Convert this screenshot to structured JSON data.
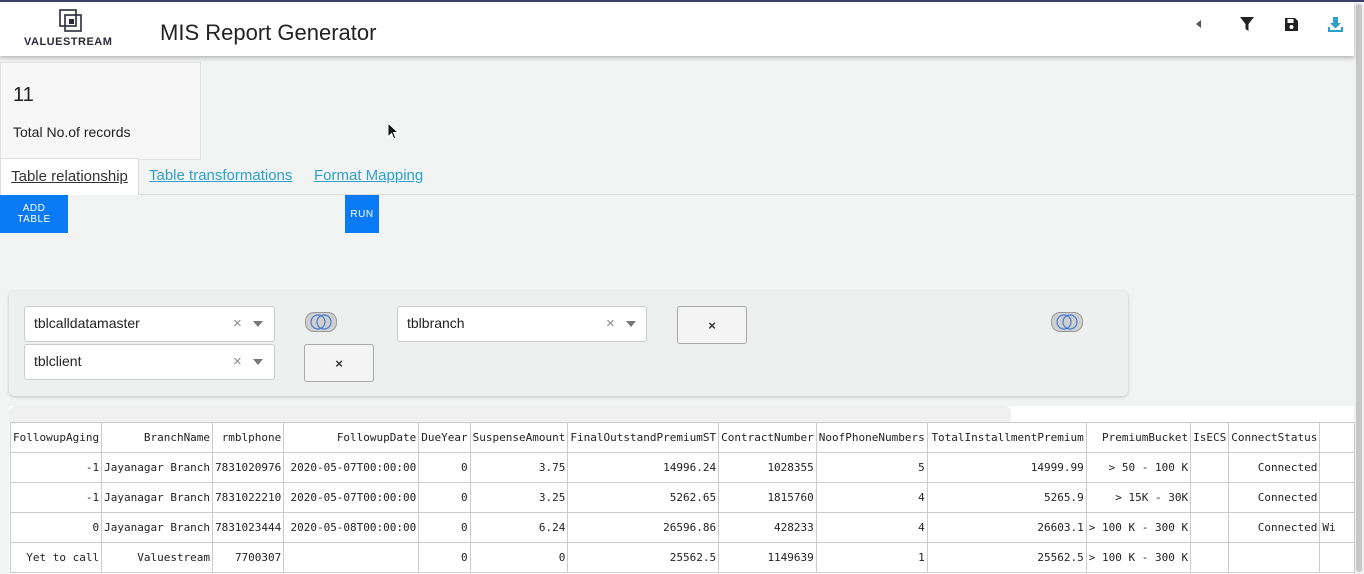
{
  "app": {
    "logo_text": "VALUESTREAM",
    "title": "MIS Report Generator"
  },
  "header_icons": [
    "collapse-left-icon",
    "filter-icon",
    "save-icon",
    "download-icon"
  ],
  "colors": {
    "accent": "#0b7bf5",
    "link": "#2ea0c8",
    "download": "#2ea0c8"
  },
  "stats": {
    "count": "11",
    "label": "Total No.of records"
  },
  "tabs": [
    {
      "label": "Table relationship",
      "active": true
    },
    {
      "label": "Table transformations",
      "active": false
    },
    {
      "label": "Format Mapping",
      "active": false
    }
  ],
  "buttons": {
    "add_table": "ADD TABLE",
    "run": "RUN"
  },
  "relationships": {
    "left_table_1": "tblcalldatamaster",
    "left_table_2": "tblclient",
    "right_table": "tblbranch",
    "clear_glyph": "×",
    "remove_glyph": "×"
  },
  "table": {
    "columns": [
      "FollowupAging",
      "BranchName",
      "rmblphone",
      "FollowupDate",
      "DueYear",
      "SuspenseAmount",
      "FinalOutstandPremiumST",
      "ContractNumber",
      "NoofPhoneNumbers",
      "TotalInstallmentPremium",
      "PremiumBucket",
      "IsECS",
      "ConnectStatus",
      ""
    ],
    "rows": [
      [
        "-1",
        "Jayanagar Branch",
        "7831020976",
        "2020-05-07T00:00:00",
        "0",
        "3.75",
        "14996.24",
        "1028355",
        "5",
        "14999.99",
        "> 50 - 100 K",
        "",
        "Connected",
        ""
      ],
      [
        "-1",
        "Jayanagar Branch",
        "7831022210",
        "2020-05-07T00:00:00",
        "0",
        "3.25",
        "5262.65",
        "1815760",
        "4",
        "5265.9",
        "> 15K - 30K",
        "",
        "Connected",
        ""
      ],
      [
        "0",
        "Jayanagar Branch",
        "7831023444",
        "2020-05-08T00:00:00",
        "0",
        "6.24",
        "26596.86",
        "428233",
        "4",
        "26603.1",
        "> 100 K - 300 K",
        "",
        "Connected",
        "Wi"
      ],
      [
        "Yet to call",
        "Valuestream",
        "7700307",
        "",
        "0",
        "0",
        "25562.5",
        "1149639",
        "1",
        "25562.5",
        "> 100 K - 300 K",
        "",
        "",
        ""
      ]
    ]
  }
}
